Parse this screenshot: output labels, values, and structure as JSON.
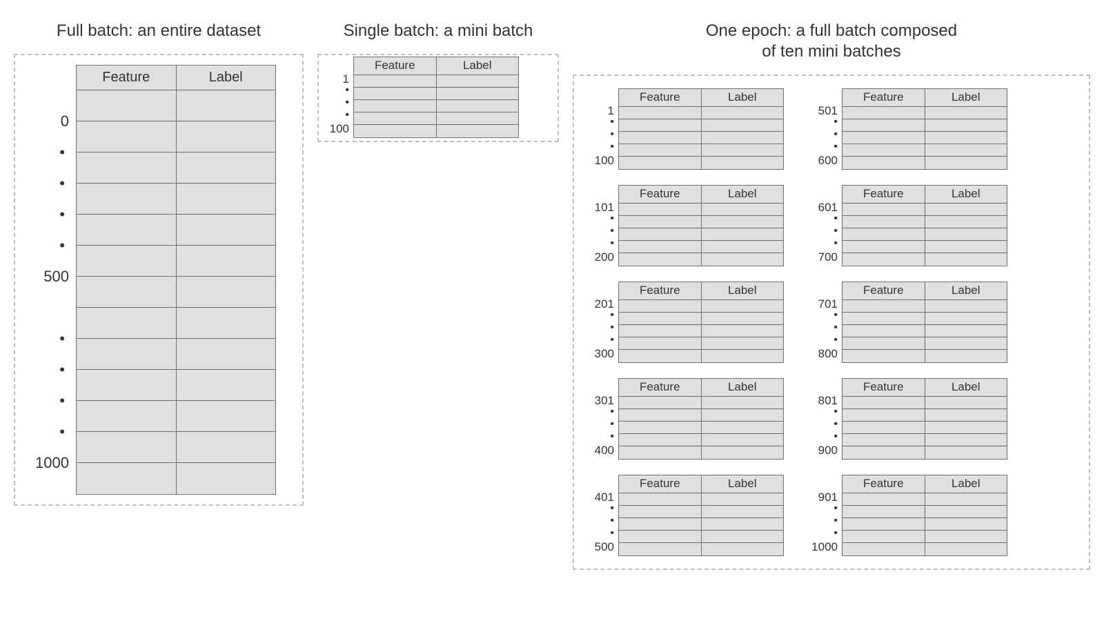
{
  "headers": {
    "feature": "Feature",
    "label": "Label"
  },
  "full": {
    "title": "Full batch: an entire dataset",
    "side_top": "0",
    "side_mid": "500",
    "side_end": "1000"
  },
  "single": {
    "title": "Single batch: a mini batch",
    "start": "1",
    "end": "100"
  },
  "epoch": {
    "title": "One epoch: a full batch composed\nof ten mini batches",
    "batches": [
      {
        "start": "1",
        "end": "100"
      },
      {
        "start": "101",
        "end": "200"
      },
      {
        "start": "201",
        "end": "300"
      },
      {
        "start": "301",
        "end": "400"
      },
      {
        "start": "401",
        "end": "500"
      },
      {
        "start": "501",
        "end": "600"
      },
      {
        "start": "601",
        "end": "700"
      },
      {
        "start": "701",
        "end": "800"
      },
      {
        "start": "801",
        "end": "900"
      },
      {
        "start": "901",
        "end": "1000"
      }
    ]
  },
  "dot": "•"
}
